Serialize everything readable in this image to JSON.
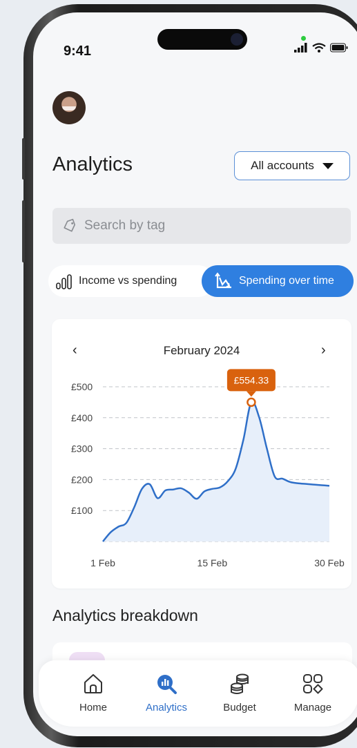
{
  "status": {
    "time": "9:41"
  },
  "header": {
    "title": "Analytics",
    "account_selector": "All accounts"
  },
  "search": {
    "placeholder": "Search by tag"
  },
  "tabs": [
    {
      "label": "Income vs spending",
      "icon": "bar-chart-icon",
      "active": false
    },
    {
      "label": "Spending over time",
      "icon": "trend-chart-icon",
      "active": true
    }
  ],
  "chart_nav": {
    "month": "February 2024",
    "prev": "‹",
    "next": "›"
  },
  "chart_data": {
    "type": "area",
    "ylabel": "",
    "y_ticks": [
      "£500",
      "£400",
      "£300",
      "£200",
      "£100"
    ],
    "y_tick_values": [
      500,
      400,
      300,
      200,
      100
    ],
    "x_ticks": [
      "1 Feb",
      "15 Feb",
      "30 Feb"
    ],
    "x_tick_values": [
      1,
      15,
      30
    ],
    "xlim": [
      1,
      30
    ],
    "ylim": [
      0,
      500
    ],
    "series": [
      {
        "x": [
          1,
          2,
          3,
          4,
          5,
          6,
          7,
          8,
          9,
          10,
          11,
          12,
          13,
          14,
          15,
          16,
          17,
          18,
          19,
          20,
          21,
          22,
          23,
          24,
          25,
          26,
          27,
          28,
          29,
          30
        ],
        "values": [
          0,
          30,
          48,
          60,
          110,
          170,
          185,
          140,
          165,
          168,
          172,
          158,
          138,
          162,
          170,
          175,
          195,
          235,
          330,
          450,
          402,
          300,
          210,
          203,
          192,
          188,
          186,
          184,
          182,
          180
        ]
      }
    ],
    "highlight": {
      "x": 20,
      "value": 450,
      "label": "£554.33"
    },
    "grid": true,
    "line_color": "#2f6fc8",
    "fill_color": "#e7effa",
    "highlight_color": "#d9620e"
  },
  "breakdown": {
    "title": "Analytics breakdown"
  },
  "bottom_nav": [
    {
      "label": "Home",
      "icon": "home-icon",
      "active": false
    },
    {
      "label": "Analytics",
      "icon": "analytics-icon",
      "active": true
    },
    {
      "label": "Budget",
      "icon": "budget-coins-icon",
      "active": false
    },
    {
      "label": "Manage",
      "icon": "manage-grid-icon",
      "active": false
    }
  ]
}
